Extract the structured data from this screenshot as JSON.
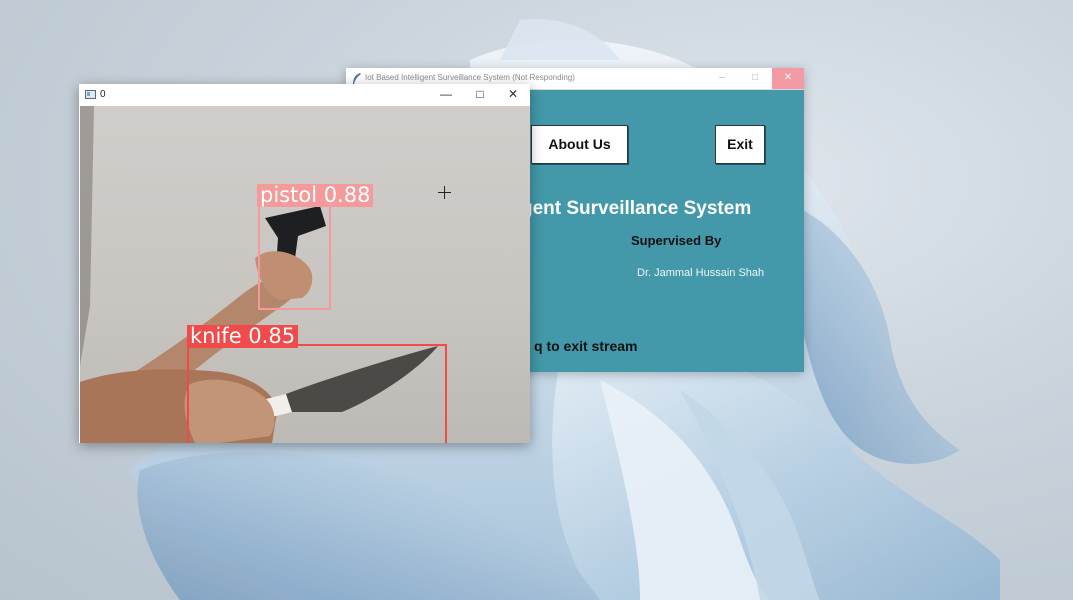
{
  "tk_window": {
    "title": "Iot Based Intelligent Surveillance System (Not Responding)",
    "minimize_glyph": "–",
    "maximize_glyph": "□",
    "close_glyph": "✕",
    "about_button": "About Us",
    "exit_button": "Exit",
    "heading": "gent Surveillance System",
    "supervised_label": "Supervised By",
    "supervisor_name": "Dr. Jammal Hussain Shah",
    "stream_hint": "q to exit stream",
    "background_color": "#4399aa"
  },
  "cv_window": {
    "title": "0",
    "minimize_glyph": "—",
    "maximize_glyph": "□",
    "close_glyph": "✕",
    "detections": [
      {
        "label": "pistol",
        "score": "0.88",
        "text": "pistol  0.88",
        "color": "#f49a9a"
      },
      {
        "label": "knife",
        "score": "0.85",
        "text": "knife  0.85",
        "color": "#f04a4a"
      }
    ]
  },
  "icons": {
    "tk_app": "feather-icon",
    "cv_app": "window-icon",
    "cursor": "crosshair-cursor-icon"
  }
}
